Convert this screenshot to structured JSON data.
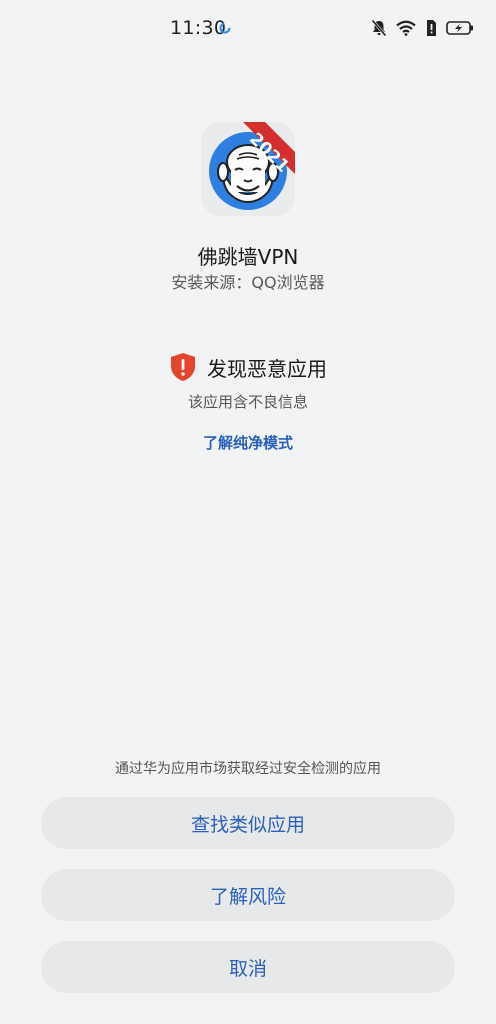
{
  "status_bar": {
    "time": "11:30",
    "icons": [
      "spinner-icon",
      "mute-bell-icon",
      "wifi-icon",
      "sim-alert-icon",
      "battery-charging-icon"
    ]
  },
  "app": {
    "name": "佛跳墙VPN",
    "install_source": "安装来源：QQ浏览器",
    "icon_badge": "2021",
    "icon_name": "buddha-app-icon"
  },
  "warning": {
    "title": "发现恶意应用",
    "description": "该应用含不良信息",
    "learn_link": "了解纯净模式",
    "icon_name": "shield-alert-icon",
    "icon_color": "#e3452f"
  },
  "footer": {
    "note": "通过华为应用市场获取经过安全检测的应用",
    "buttons": {
      "find_similar": "查找类似应用",
      "learn_risk": "了解风险",
      "cancel": "取消"
    }
  },
  "colors": {
    "background": "#f1f3f5",
    "accent": "#2a5fbf",
    "button_bg": "#e6e8ea",
    "badge_red": "#d32f2f"
  }
}
